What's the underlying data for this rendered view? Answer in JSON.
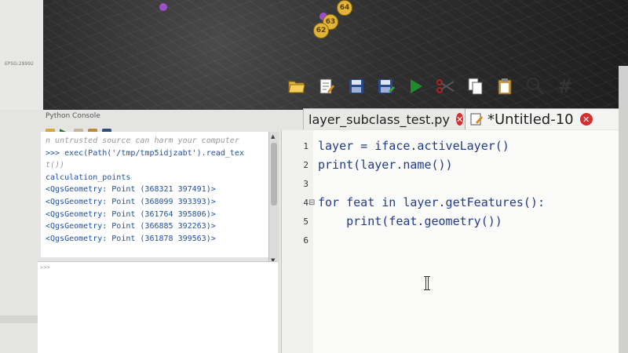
{
  "map": {
    "clusters": [
      "64",
      "63",
      "62"
    ]
  },
  "left_panel": {
    "label": "EPSG:28992"
  },
  "console": {
    "title": "Python Console",
    "lines": [
      "n untrusted source can harm your computer",
      ">>> exec(Path('/tmp/tmp5idjzabt').read_tex",
      "t())",
      "calculation_points",
      "<QgsGeometry: Point (368321 397491)>",
      "<QgsGeometry: Point (368099 393393)>",
      "<QgsGeometry: Point (361764 395806)>",
      "<QgsGeometry: Point (366885 392263)>",
      "<QgsGeometry: Point (361878 399563)>"
    ],
    "input_prompt": ">>>"
  },
  "editor": {
    "tabs": [
      {
        "label": "layer_subclass_test.py"
      },
      {
        "label": "*Untitled-10"
      }
    ],
    "line_numbers": [
      "1",
      "2",
      "3",
      "4",
      "5",
      "6"
    ],
    "code": [
      "layer = iface.activeLayer()",
      "print(layer.name())",
      "",
      "for feat in layer.getFeatures():",
      "    print(feat.geometry())",
      ""
    ]
  },
  "icons": {
    "toolbar": [
      "open-folder-icon",
      "edit-icon",
      "save-icon",
      "save-as-icon",
      "run-icon",
      "cut-icon",
      "copy-icon",
      "paste-icon",
      "find-icon",
      "comment-icon"
    ]
  },
  "colors": {
    "keyword": "#2a4bd7",
    "code": "#1f3b8c",
    "close": "#d62f2f",
    "run": "#1f8a2e",
    "cluster": "#e2b43a"
  }
}
